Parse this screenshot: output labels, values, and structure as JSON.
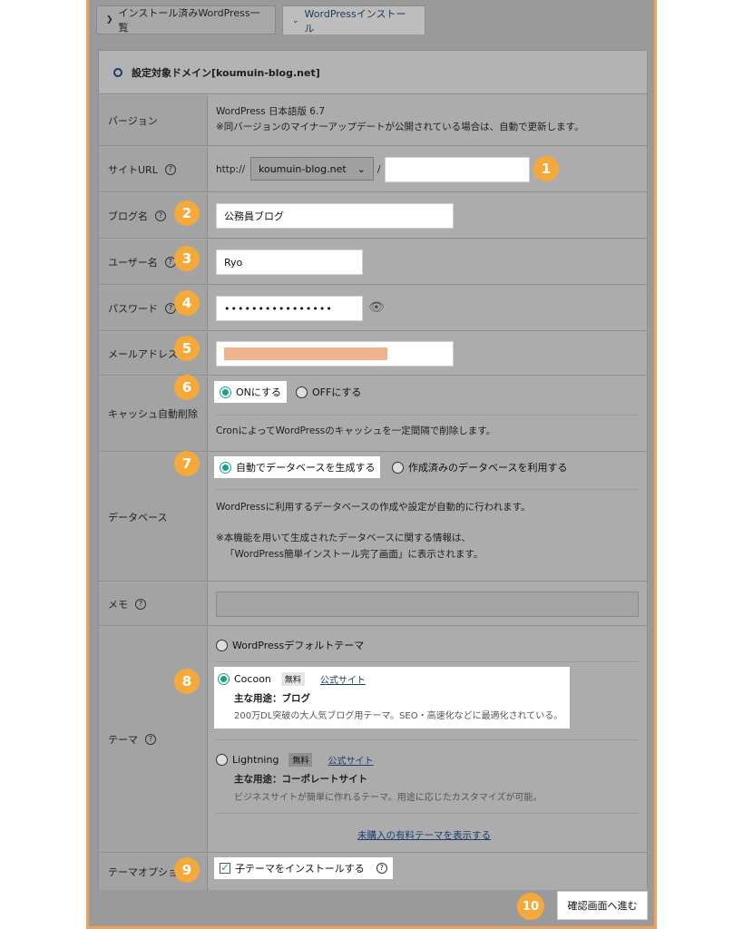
{
  "tabs": {
    "installed": "インストール済みWordPress一覧",
    "install": "WordPressインストール"
  },
  "domain_heading": "設定対象ドメイン[koumuin-blog.net]",
  "version": {
    "label": "バージョン",
    "line1": "WordPress 日本語版 6.7",
    "line2": "※同バージョンのマイナーアップデートが公開されている場合は、自動で更新します。"
  },
  "site_url": {
    "label": "サイトURL",
    "prefix": "http://",
    "domain": "koumuin-blog.net",
    "slash": "/",
    "path": ""
  },
  "blog_name": {
    "label": "ブログ名",
    "value": "公務員ブログ"
  },
  "username": {
    "label": "ユーザー名",
    "value": "Ryo"
  },
  "password": {
    "label": "パスワード",
    "value": "••••••••••••••••"
  },
  "email": {
    "label": "メールアドレス",
    "redacted_color": "#f1b38c"
  },
  "cache": {
    "label": "キャッシュ自動削除",
    "on": "ONにする",
    "off": "OFFにする",
    "note": "CronによってWordPressのキャッシュを一定間隔で削除します。"
  },
  "database": {
    "label": "データベース",
    "auto": "自動でデータベースを生成する",
    "existing": "作成済みのデータベースを利用する",
    "note1": "WordPressに利用するデータベースの作成や設定が自動的に行われます。",
    "note2": "※本機能を用いて生成されたデータベースに関する情報は、",
    "note3": "「WordPress簡単インストール完了画面」に表示されます。"
  },
  "memo": {
    "label": "メモ",
    "value": ""
  },
  "theme": {
    "label": "テーマ",
    "default": "WordPressデフォルトテーマ",
    "cocoon": {
      "name": "Cocoon",
      "badge": "無料",
      "link": "公式サイト",
      "use": "主な用途：ブログ",
      "desc": "200万DL突破の大人気ブログ用テーマ。SEO・高速化などに最適化されている。"
    },
    "lightning": {
      "name": "Lightning",
      "badge": "無料",
      "link": "公式サイト",
      "use": "主な用途：コーポレートサイト",
      "desc": "ビジネスサイトが簡単に作れるテーマ。用途に応じたカスタマイズが可能。"
    },
    "paid_link": "未購入の有料テーマを表示する"
  },
  "theme_option": {
    "label": "テーマオプション",
    "child": "子テーマをインストールする"
  },
  "confirm_button": "確認画面へ進む",
  "step_numbers": [
    "1",
    "2",
    "3",
    "4",
    "5",
    "6",
    "7",
    "8",
    "9",
    "10"
  ],
  "colors": {
    "accent": "#f4a93a",
    "radio_on": "#17a08a",
    "frame": "#f0a25a"
  }
}
